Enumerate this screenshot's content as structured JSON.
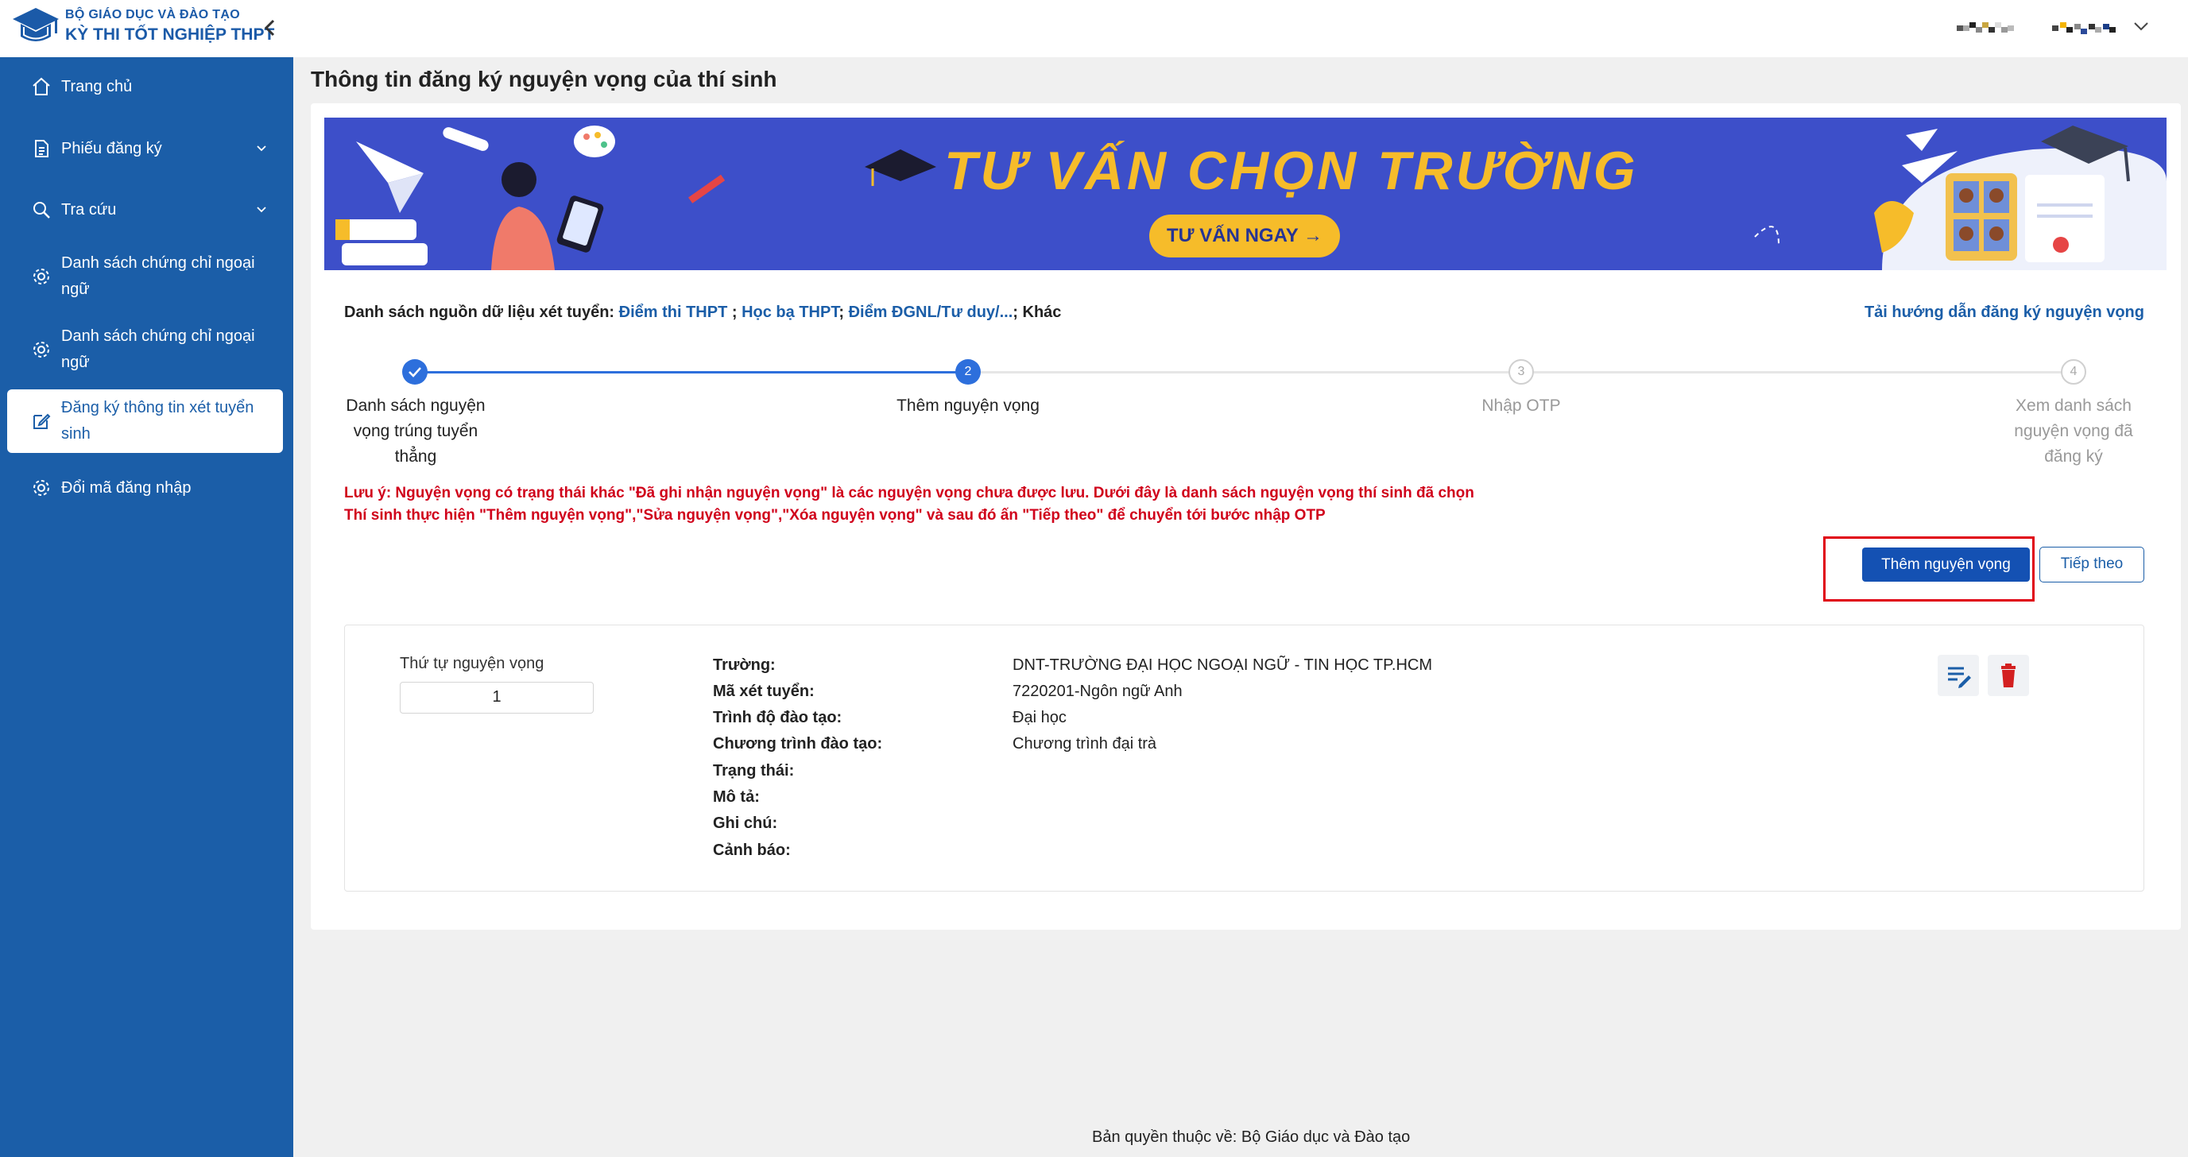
{
  "header": {
    "org": "BỘ GIÁO DỤC VÀ ĐÀO TẠO",
    "exam": "KỲ THI TỐT NGHIỆP THPT",
    "collapse_icon": "chevron-left-icon",
    "user_menu_icon": "chevron-down-icon"
  },
  "sidebar": {
    "items": [
      {
        "label": "Trang chủ",
        "icon": "home-icon"
      },
      {
        "label": "Phiếu đăng ký",
        "icon": "document-icon",
        "expandable": true
      },
      {
        "label": "Tra cứu",
        "icon": "search-icon",
        "expandable": true
      },
      {
        "label": "Danh sách chứng chỉ ngoại ngữ",
        "icon": "gear-icon"
      },
      {
        "label": "Danh sách chứng chỉ ngoại ngữ",
        "icon": "gear-icon"
      },
      {
        "label": "Đăng ký thông tin xét tuyển sinh",
        "icon": "edit-icon",
        "active": true
      },
      {
        "label": "Đổi mã đăng nhập",
        "icon": "gear-icon"
      }
    ]
  },
  "page": {
    "title": "Thông tin đăng ký nguyện vọng của thí sinh"
  },
  "banner": {
    "title": "TƯ VẤN CHỌN TRƯỜNG",
    "cta": "TƯ VẤN NGAY →"
  },
  "sources": {
    "prefix": "Danh sách nguồn dữ liệu xét tuyển:",
    "link1": "Điểm thi THPT",
    "sep1": " ; ",
    "link2": "Học bạ THPT",
    "sep2": "; ",
    "link3": "Điểm ĐGNL/Tư duy/...",
    "suffix": "; Khác",
    "guide": "Tải hướng dẫn đăng ký nguyện vọng"
  },
  "steps": [
    {
      "num": "✓",
      "label": "Danh sách nguyện vọng trúng tuyển thẳng",
      "state": "done"
    },
    {
      "num": "2",
      "label": "Thêm nguyện vọng",
      "state": "current"
    },
    {
      "num": "3",
      "label": "Nhập OTP",
      "state": "pending"
    },
    {
      "num": "4",
      "label": "Xem danh sách nguyện vọng đã đăng ký",
      "state": "pending"
    }
  ],
  "notes": {
    "line1": "Lưu ý: Nguyện vọng có trạng thái khác \"Đã ghi nhận nguyện vọng\" là các nguyện vọng chưa được lưu. Dưới đây là danh sách nguyện vọng thí sinh đã chọn",
    "line2": "Thí sinh thực hiện \"Thêm nguyện vọng\",\"Sửa nguyện vọng\",\"Xóa nguyện vọng\" và sau đó ấn \"Tiếp theo\" để chuyển tới bước nhập OTP"
  },
  "actions": {
    "add": "Thêm nguyện vọng",
    "next": "Tiếp theo"
  },
  "wish": {
    "order_label": "Thứ tự nguyện vọng",
    "order_value": "1",
    "fields": [
      {
        "key": "Trường:",
        "value": "DNT-TRƯỜNG ĐẠI HỌC NGOẠI NGỮ - TIN HỌC TP.HCM"
      },
      {
        "key": "Mã xét tuyển:",
        "value": "7220201-Ngôn ngữ Anh"
      },
      {
        "key": "Trình độ đào tạo:",
        "value": "Đại học"
      },
      {
        "key": "Chương trình đào tạo:",
        "value": "Chương trình đại trà"
      },
      {
        "key": "Trạng thái:",
        "value": ""
      },
      {
        "key": "Mô tả:",
        "value": ""
      },
      {
        "key": "Ghi chú:",
        "value": ""
      },
      {
        "key": "Cảnh báo:",
        "value": ""
      }
    ],
    "edit_icon": "edit-list-icon",
    "delete_icon": "trash-icon"
  },
  "footer": {
    "text": "Bản quyền thuộc về: Bộ Giáo dục và Đào tạo"
  },
  "colors": {
    "sidebar": "#1b5ea8",
    "primary_button": "#1451b3",
    "warning_text": "#d0021b",
    "banner_bg": "#3d4fc9",
    "banner_text": "#f6bc2a",
    "delete_icon": "#d32020"
  }
}
